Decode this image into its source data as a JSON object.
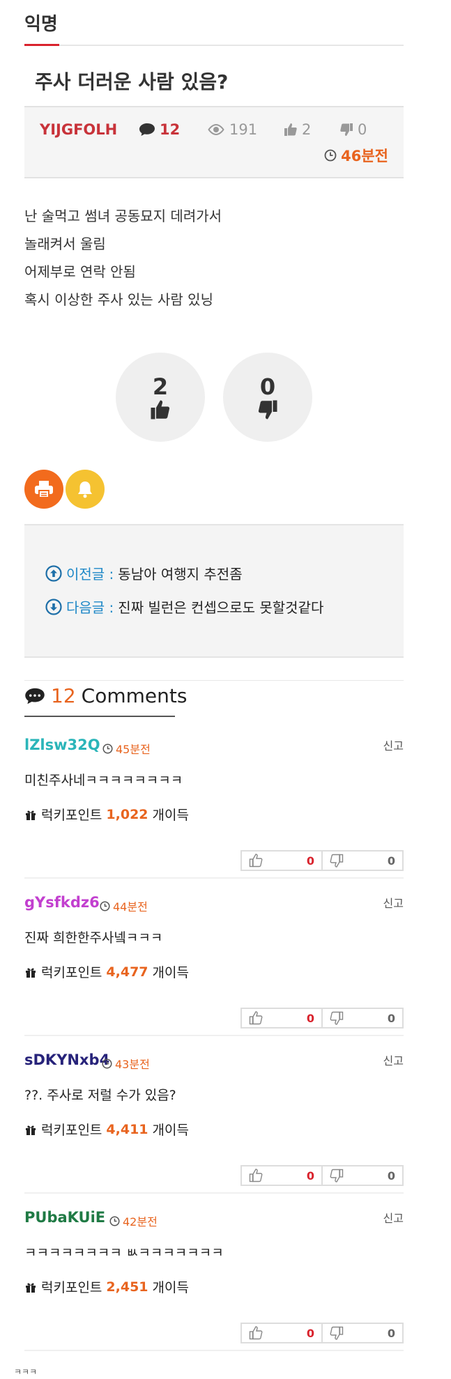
{
  "board": {
    "title": "익명"
  },
  "post": {
    "title": "주사 더러운 사람 있음?",
    "author": "YIJGFOLH",
    "comments": "12",
    "views": "191",
    "likes": "2",
    "dislikes": "0",
    "time": "46분전",
    "body": [
      "난 술먹고 썸녀 공동묘지 데려가서",
      "놀래켜서 울림",
      "어제부로 연락 안됨",
      "혹시 이상한 주사 있는 사람 있닝"
    ],
    "vote_up": "2",
    "vote_down": "0"
  },
  "nav": {
    "prev_label": "이전글 :",
    "prev_title": "동남아 여행지 추전좀",
    "next_label": "다음글 :",
    "next_title": "진짜 빌런은 컨셉으로도 못할것같다"
  },
  "comments_header": {
    "count": "12",
    "label": "Comments"
  },
  "comments": [
    {
      "author": "lZlsw32Q",
      "color": "#2bb5b9",
      "time": "45분전",
      "report": "신고",
      "text": "미친주사네ㅋㅋㅋㅋㅋㅋㅋㅋ",
      "point_label": "럭키포인트",
      "points": "1,022",
      "point_suffix": "개이득",
      "up": "0",
      "down": "0"
    },
    {
      "author": "gYsfkdz6",
      "color": "#c23fcf",
      "time": "44분전",
      "report": "신고",
      "text": "진짜 희한한주사넼ㅋㅋㅋ",
      "point_label": "럭키포인트",
      "points": "4,477",
      "point_suffix": "개이득",
      "up": "0",
      "down": "0"
    },
    {
      "author": "sDKYNxb4",
      "color": "#27237a",
      "time": "43분전",
      "report": "신고",
      "text": "??. 주사로 저럴 수가 있음?",
      "point_label": "럭키포인트",
      "points": "4,411",
      "point_suffix": "개이득",
      "up": "0",
      "down": "0"
    },
    {
      "author": "PUbaKUiE",
      "color": "#1f7a44",
      "time": "42분전",
      "report": "신고",
      "text": "ㅋㅋㅋㅋㅋㅋㅋㅋ ㅄㅋㅋㅋㅋㅋㅋㅋ",
      "point_label": "럭키포인트",
      "points": "2,451",
      "point_suffix": "개이득",
      "up": "0",
      "down": "0"
    }
  ],
  "footer": {
    "text": "ㅋㅋㅋ"
  },
  "icons": {
    "comment": "speech-bubble-icon",
    "views": "eye-icon",
    "likes": "thumbs-up-icon",
    "dislikes": "thumbs-down-icon",
    "time": "clock-icon",
    "print": "printer-icon",
    "bell": "bell-icon",
    "prev": "arrow-up-circle-icon",
    "next": "arrow-down-circle-icon",
    "gift": "gift-icon"
  },
  "colors": {
    "accent": "#d9232d",
    "orange": "#e8641f",
    "link": "#1e88c7"
  }
}
